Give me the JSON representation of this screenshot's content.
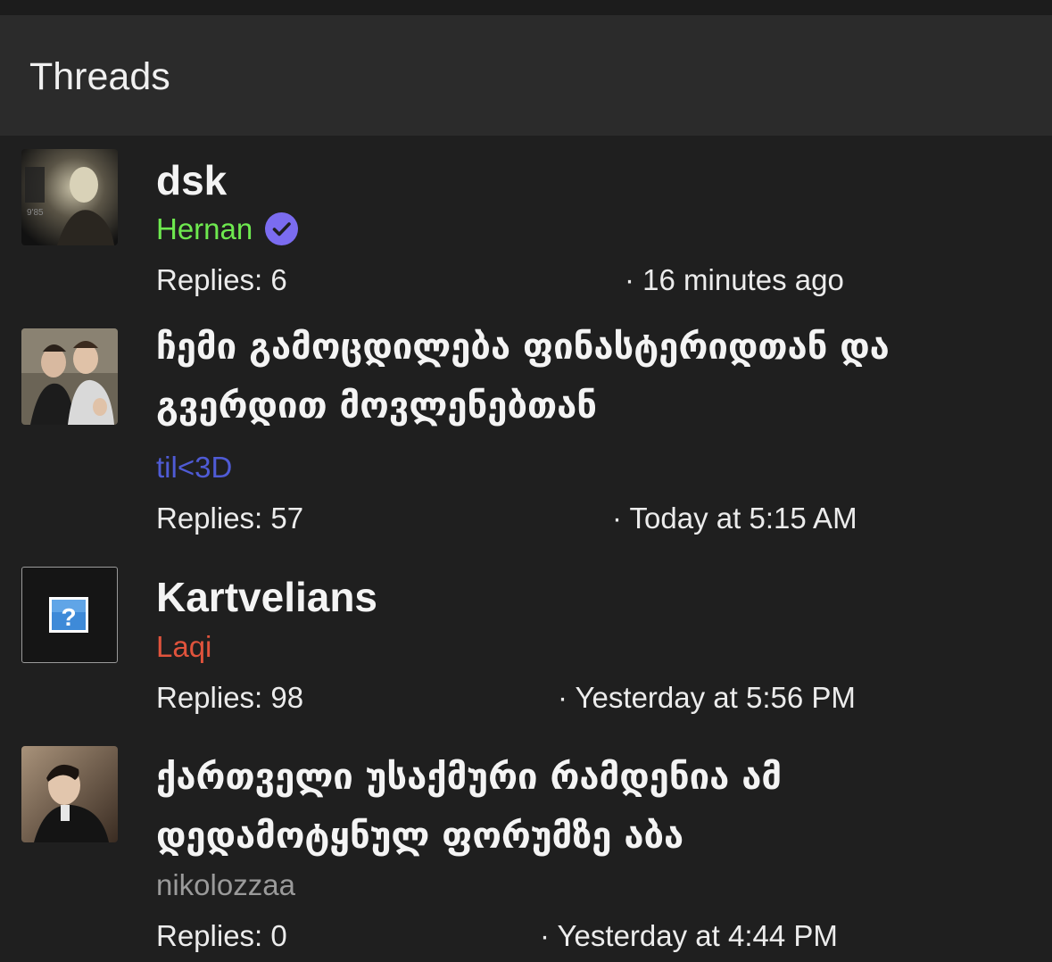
{
  "header": {
    "title": "Threads"
  },
  "colors": {
    "background": "#1f1f1f",
    "header_background": "#2b2b2b",
    "verified_badge": "#7b6cf0"
  },
  "threads": [
    {
      "title": "dsk",
      "author": "Hernan",
      "author_color": "#6ee94f",
      "verified": true,
      "replies": "Replies: 6",
      "time": "· 16 minutes ago",
      "avatar_icon": "user-photo"
    },
    {
      "title": "ჩემი გამოცდილება ფინასტერიდთან და გვერდით მოვლენებთან",
      "author": "til<3D",
      "author_color": "#4f5bd5",
      "replies": "Replies: 57",
      "time": "· Today at 5:15 AM",
      "avatar_icon": "user-photo"
    },
    {
      "title": "Kartvelians",
      "author": "Laqi",
      "author_color": "#e0533c",
      "replies": "Replies: 98",
      "time": "· Yesterday at 5:56 PM",
      "avatar_icon": "missing-image-icon"
    },
    {
      "title": "ქართველი უსაქმური რამდენია ამ დედამოტყნულ ფორუმზე აბა",
      "author": "nikolozzaa",
      "author_color": "#9a9a9a",
      "replies": "Replies: 0",
      "time": "· Yesterday at 4:44 PM",
      "avatar_icon": "user-photo"
    }
  ]
}
